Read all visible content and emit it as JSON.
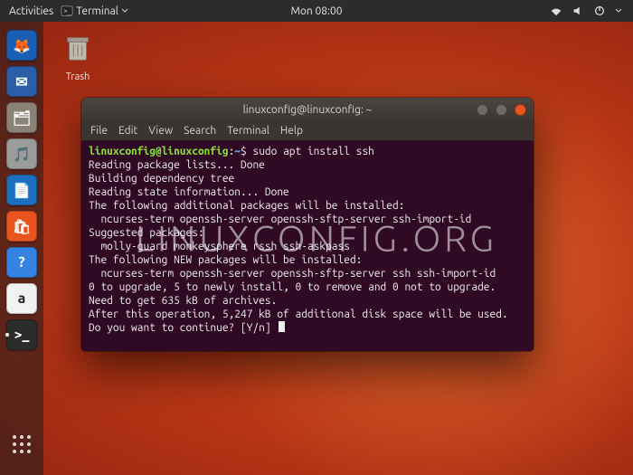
{
  "topbar": {
    "activities": "Activities",
    "app_label": "Terminal",
    "clock": "Mon 08:00"
  },
  "desktop": {
    "trash_label": "Trash"
  },
  "dock": {
    "items": [
      {
        "name": "firefox",
        "bg": "#1b5fb4",
        "glyph": "🦊",
        "running": false
      },
      {
        "name": "thunderbird",
        "bg": "#2a5ea8",
        "glyph": "✉",
        "running": false
      },
      {
        "name": "files",
        "bg": "#8b8378",
        "glyph": "🗂",
        "running": false
      },
      {
        "name": "rhythmbox",
        "bg": "#9c9c9c",
        "glyph": "🎵",
        "running": false
      },
      {
        "name": "writer",
        "bg": "#1e6fc0",
        "glyph": "📄",
        "running": false
      },
      {
        "name": "software",
        "bg": "#e95420",
        "glyph": "🛍",
        "running": false
      },
      {
        "name": "help",
        "bg": "#3584e4",
        "glyph": "?",
        "running": false
      },
      {
        "name": "amazon",
        "bg": "#f2f2f2",
        "glyph": "a",
        "running": false
      },
      {
        "name": "terminal",
        "bg": "#2c2c2c",
        "glyph": ">_",
        "running": true
      }
    ]
  },
  "window": {
    "title": "linuxconfig@linuxconfig: ~",
    "menus": [
      "File",
      "Edit",
      "View",
      "Search",
      "Terminal",
      "Help"
    ]
  },
  "terminal": {
    "prompt_user": "linuxconfig@linuxconfig",
    "prompt_sep": ":",
    "prompt_path": "~",
    "prompt_sym": "$",
    "command": "sudo apt install ssh",
    "lines": [
      "Reading package lists... Done",
      "Building dependency tree",
      "Reading state information... Done",
      "The following additional packages will be installed:",
      "  ncurses-term openssh-server openssh-sftp-server ssh-import-id",
      "Suggested packages:",
      "  molly-guard monkeysphere rssh ssh-askpass",
      "The following NEW packages will be installed:",
      "  ncurses-term openssh-server openssh-sftp-server ssh ssh-import-id",
      "0 to upgrade, 5 to newly install, 0 to remove and 0 not to upgrade.",
      "Need to get 635 kB of archives.",
      "After this operation, 5,247 kB of additional disk space will be used.",
      "Do you want to continue? [Y/n] "
    ]
  },
  "watermark": "LINUXCONFIG.ORG"
}
